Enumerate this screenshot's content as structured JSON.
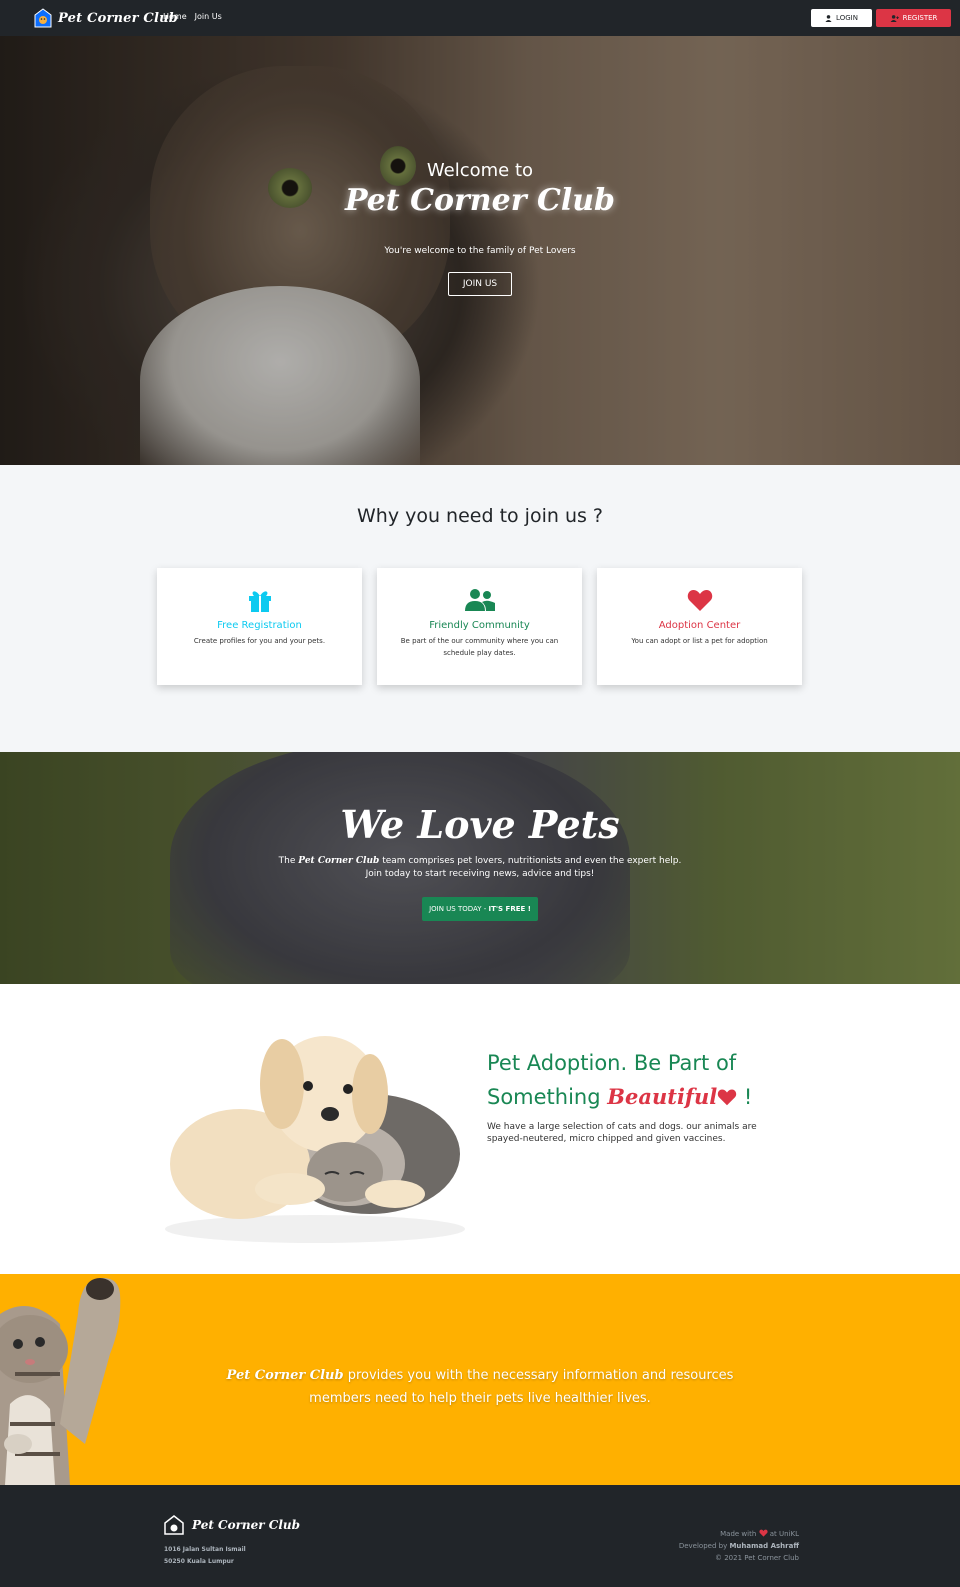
{
  "navbar": {
    "brand": "Pet Corner Club",
    "links": [
      "Home",
      "Join Us"
    ],
    "login_label": "LOGIN",
    "register_label": "REGISTER"
  },
  "hero": {
    "welcome": "Welcome to",
    "brand": "Pet Corner Club",
    "subtitle": "You're welcome to the family of Pet Lovers",
    "button": "JOIN US"
  },
  "why": {
    "title": "Why you need to join us ?",
    "cards": [
      {
        "title": "Free Registration",
        "desc": "Create profiles for you and your pets.",
        "color": "#0dcaf0",
        "icon": "gift-icon"
      },
      {
        "title": "Friendly Community",
        "desc": "Be part of the our community where you can schedule play dates.",
        "color": "#198754",
        "icon": "users-icon"
      },
      {
        "title": "Adoption Center",
        "desc": "You can adopt or list a pet for adoption",
        "color": "#dc3545",
        "icon": "heart-icon"
      }
    ]
  },
  "love": {
    "title": "We Love Pets",
    "text_prefix": "The",
    "text_brand": "Pet Corner Club",
    "text_rest": "team comprises pet lovers, nutritionists and even the expert help.",
    "text_line2": "Join today to start receiving news, advice and tips!",
    "button_main": "JOIN US TODAY -",
    "button_bold": "IT'S FREE !"
  },
  "adopt": {
    "title_line1": "Pet Adoption. Be Part of",
    "title_line2_prefix": "Something",
    "title_beautiful": "Beautiful",
    "title_suffix": "!",
    "text": "We have a large selection of cats and dogs. our animals are spayed-neutered, micro chipped and given vaccines."
  },
  "yellow": {
    "brand": "Pet Corner Club",
    "text_rest": "provides you with the necessary information and resources",
    "text_line2": "members need to help their pets live healthier lives."
  },
  "footer": {
    "brand": "Pet Corner Club",
    "address_line1": "1016 Jalan Sultan Ismail",
    "address_line2": "50250 Kuala Lumpur",
    "made_prefix": "Made with",
    "made_suffix": "at UniKL",
    "developed_prefix": "Developed by",
    "developer": "Muhamad Ashraff",
    "copyright": "© 2021 Pet Corner Club"
  },
  "colors": {
    "dark": "#212529",
    "red": "#dc3545",
    "green": "#198754",
    "cyan": "#0dcaf0",
    "yellow": "#ffb000"
  }
}
